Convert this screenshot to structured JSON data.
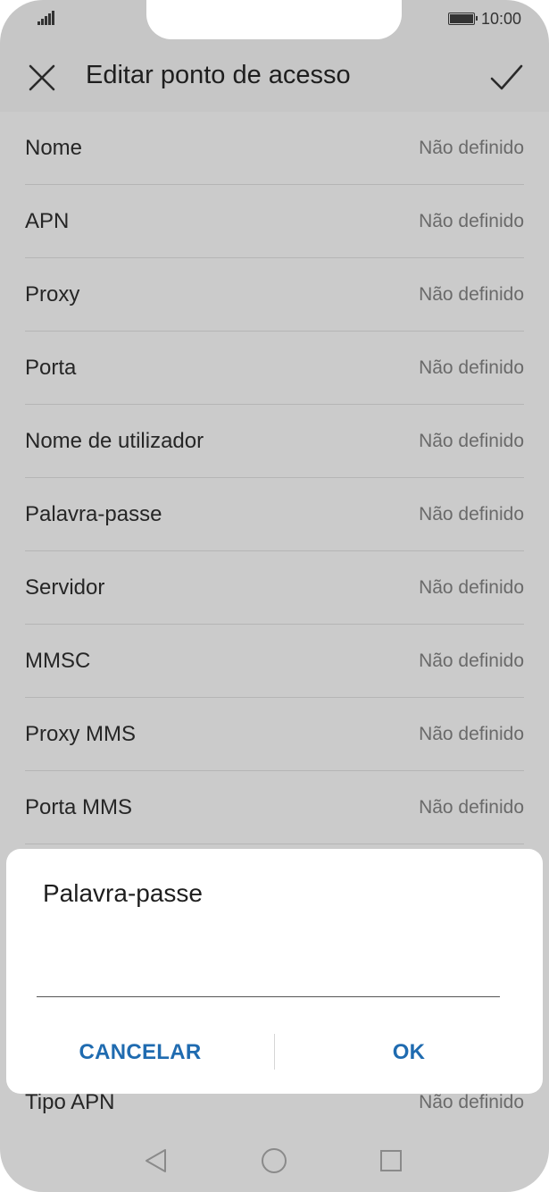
{
  "status_bar": {
    "time": "10:00"
  },
  "app_bar": {
    "title": "Editar ponto de acesso"
  },
  "list": {
    "items": [
      {
        "label": "Nome",
        "value": "Não definido"
      },
      {
        "label": "APN",
        "value": "Não definido"
      },
      {
        "label": "Proxy",
        "value": "Não definido"
      },
      {
        "label": "Porta",
        "value": "Não definido"
      },
      {
        "label": "Nome de utilizador",
        "value": "Não definido"
      },
      {
        "label": "Palavra-passe",
        "value": "Não definido"
      },
      {
        "label": "Servidor",
        "value": "Não definido"
      },
      {
        "label": "MMSC",
        "value": "Não definido"
      },
      {
        "label": "Proxy MMS",
        "value": "Não definido"
      },
      {
        "label": "Porta MMS",
        "value": "Não definido"
      },
      {
        "label": "Tipo APN",
        "value": "Não definido"
      }
    ]
  },
  "dialog": {
    "title": "Palavra-passe",
    "input_value": "",
    "cancel_label": "CANCELAR",
    "ok_label": "OK"
  },
  "colors": {
    "dim_background": "#cbcbcb",
    "accent": "#1f6bb0"
  },
  "icons": {
    "close": "close-icon",
    "confirm": "check-icon",
    "back": "back-triangle-icon",
    "home": "home-circle-icon",
    "recent": "recent-apps-square-icon"
  }
}
